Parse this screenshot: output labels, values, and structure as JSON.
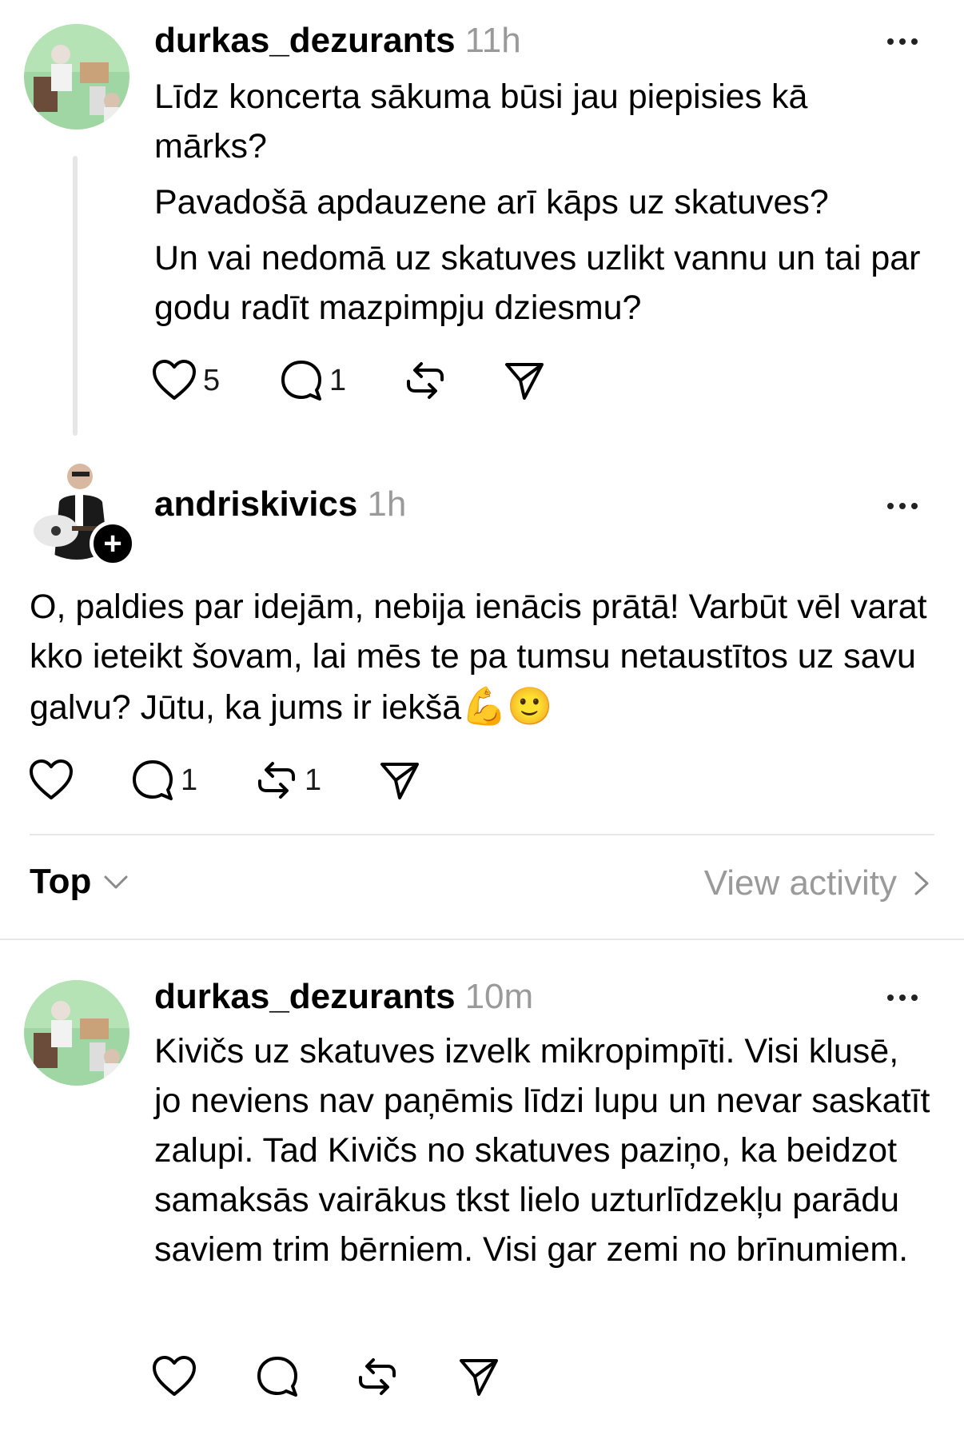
{
  "posts": [
    {
      "username": "durkas_dezurants",
      "time": "11h",
      "paragraphs": [
        "Līdz koncerta sākuma būsi jau piepisies kā mārks?",
        "Pavadošā apdauzene arī kāps uz skatuves?",
        "Un vai nedomā uz skatuves uzlikt vannu un tai par godu radīt mazpimpju dziesmu?"
      ],
      "likes": "5",
      "replies": "1",
      "reposts": ""
    },
    {
      "username": "andriskivics",
      "time": "1h",
      "text": "O, paldies par idejām, nebija ienācis prātā! Varbūt vēl varat kko ieteikt šovam, lai mēs te pa tumsu netaustītos uz savu galvu? Jūtu, ka jums ir iekšā",
      "emojis": "💪🙂",
      "likes": "",
      "replies": "1",
      "reposts": "1"
    },
    {
      "username": "durkas_dezurants",
      "time": "10m",
      "text": "Kivičs uz skatuves izvelk mikropimpīti. Visi klusē, jo neviens nav paņēmis līdzi lupu un nevar saskatīt zalupi. Tad Kivičs no skatuves paziņo, ka beidzot samaksās vairākus tkst lielo uzturlīdzekļu parādu saviem trim bērniem. Visi gar zemi no brīnumiem.",
      "likes": "",
      "replies": "",
      "reposts": ""
    }
  ],
  "sort": {
    "label": "Top"
  },
  "view_activity": {
    "label": "View activity"
  },
  "icons": {
    "like": "heart-icon",
    "reply": "comment-icon",
    "repost": "repost-icon",
    "share": "send-icon",
    "more": "more-icon",
    "follow": "plus-icon"
  }
}
